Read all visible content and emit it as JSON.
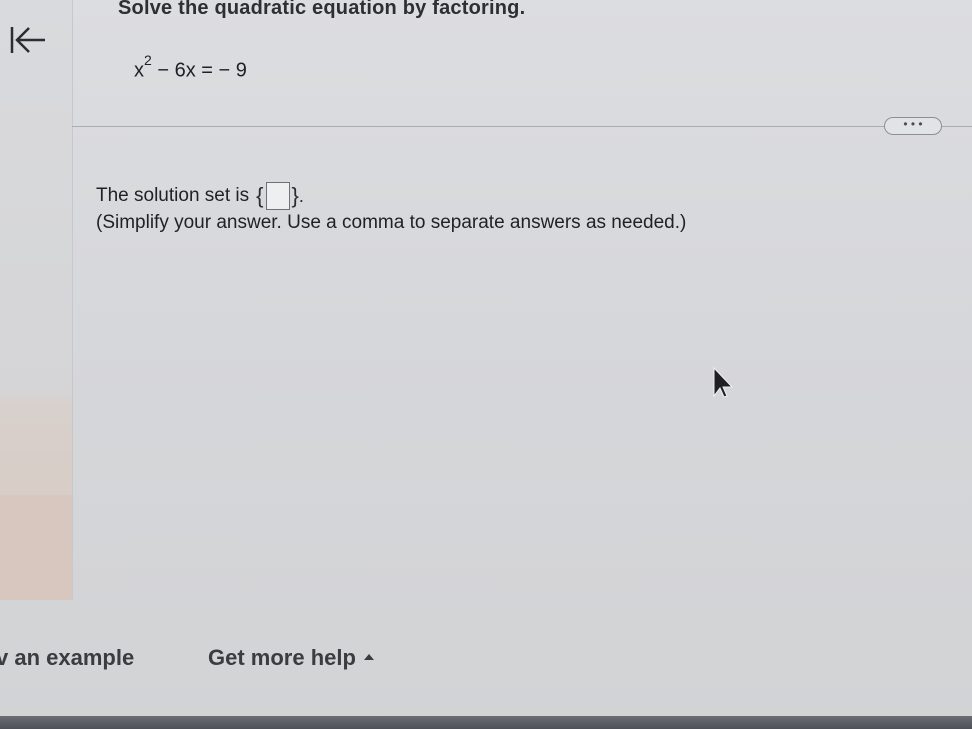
{
  "question": {
    "title": "Solve the quadratic equation by factoring.",
    "equation": {
      "base": "x",
      "exponent": "2",
      "rest": "− 6x = − 9"
    }
  },
  "toolbar": {
    "more_label": "• • •"
  },
  "answer": {
    "prompt": "The solution set is",
    "open_brace": "{",
    "close_brace": "}",
    "end_punct": ".",
    "value": "",
    "instruction": "(Simplify your answer. Use a comma to separate answers as needed.)"
  },
  "footer": {
    "example_label": "v an example",
    "help_label": "Get more help"
  },
  "icons": {
    "back": "back-arrow-icon",
    "more": "ellipsis-icon",
    "help_caret": "caret-up-icon",
    "cursor": "mouse-pointer-icon"
  }
}
